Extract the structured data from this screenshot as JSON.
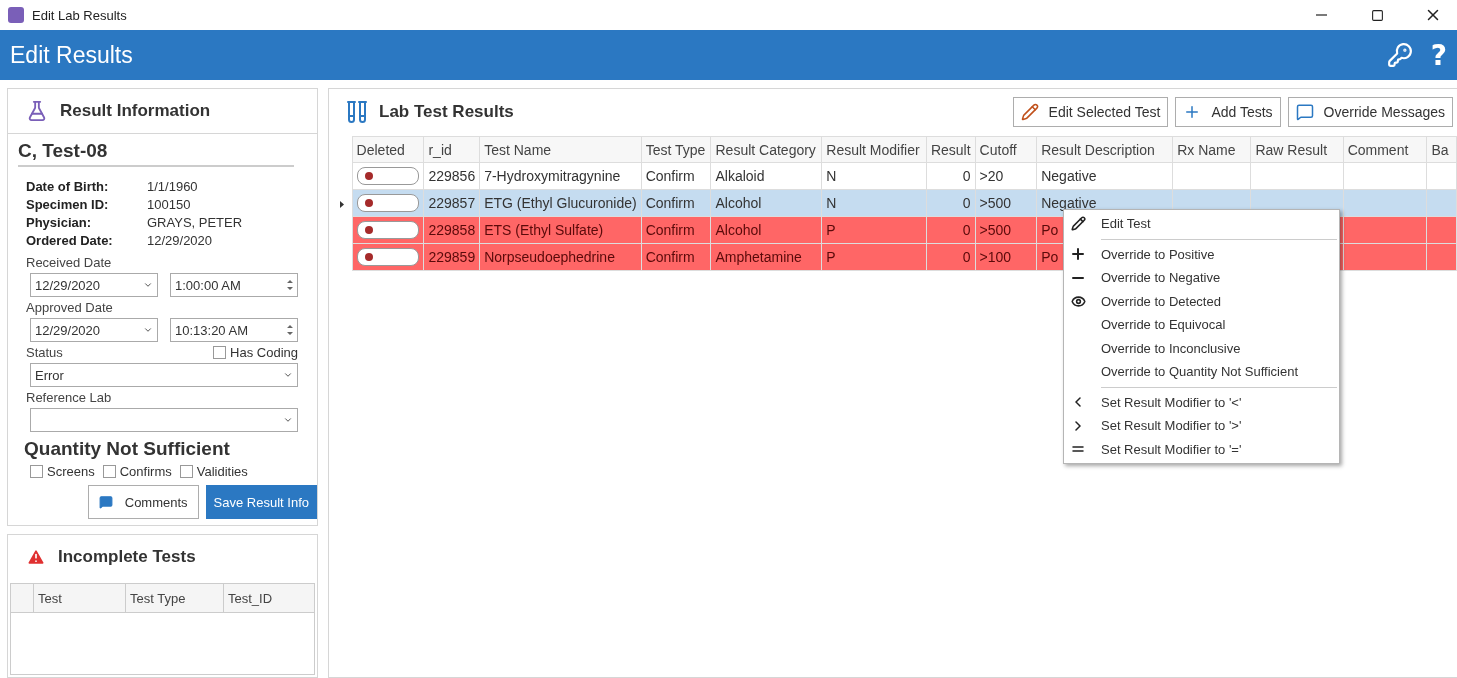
{
  "window": {
    "title": "Edit Lab Results"
  },
  "header": {
    "title": "Edit Results",
    "help": "?"
  },
  "result_info": {
    "title": "Result Information",
    "patient": "C, Test-08",
    "details": [
      {
        "label": "Date of Birth:",
        "value": "1/1/1960"
      },
      {
        "label": "Specimen ID:",
        "value": "100150"
      },
      {
        "label": "Physician:",
        "value": "GRAYS, PETER"
      },
      {
        "label": "Ordered Date:",
        "value": "12/29/2020"
      }
    ],
    "received": {
      "label": "Received Date",
      "date": "12/29/2020",
      "time": "1:00:00 AM"
    },
    "approved": {
      "label": "Approved Date",
      "date": "12/29/2020",
      "time": "10:13:20 AM"
    },
    "status": {
      "label": "Status",
      "value": "Error"
    },
    "has_coding": {
      "label": "Has Coding",
      "checked": false
    },
    "reference_lab": {
      "label": "Reference Lab"
    },
    "qns": {
      "title": "Quantity Not Sufficient",
      "options": [
        {
          "label": "Screens",
          "checked": false
        },
        {
          "label": "Confirms",
          "checked": false
        },
        {
          "label": "Validities",
          "checked": false
        }
      ]
    },
    "buttons": {
      "comments": "Comments",
      "save": "Save Result Info"
    }
  },
  "incomplete_tests": {
    "title": "Incomplete Tests",
    "columns": [
      "Test",
      "Test Type",
      "Test_ID"
    ]
  },
  "lab_results": {
    "title": "Lab Test Results",
    "toolbar": [
      {
        "kind": "edit",
        "label": "Edit Selected Test"
      },
      {
        "kind": "add",
        "label": "Add Tests"
      },
      {
        "kind": "message",
        "label": "Override Messages"
      }
    ],
    "columns": [
      "Deleted",
      "r_id",
      "Test Name",
      "Test Type",
      "Result Category",
      "Result Modifier",
      "Result",
      "Cutoff",
      "Result Description",
      "Rx Name",
      "Raw Result",
      "Comment",
      "Ba"
    ],
    "rows": [
      {
        "selected": false,
        "positive": false,
        "deleted": false,
        "cells": [
          "",
          "229856",
          "7-Hydroxymitragynine",
          "Confirm",
          "Alkaloid",
          "N",
          "0",
          ">20",
          "Negative",
          "",
          "",
          "",
          ""
        ]
      },
      {
        "selected": true,
        "positive": false,
        "deleted": false,
        "cells": [
          "",
          "229857",
          "ETG (Ethyl Glucuronide)",
          "Confirm",
          "Alcohol",
          "N",
          "0",
          ">500",
          "Negative",
          "",
          "",
          "",
          ""
        ]
      },
      {
        "selected": false,
        "positive": true,
        "deleted": false,
        "cells": [
          "",
          "229858",
          "ETS (Ethyl Sulfate)",
          "Confirm",
          "Alcohol",
          "P",
          "0",
          ">500",
          "Po",
          "",
          "",
          "",
          ""
        ]
      },
      {
        "selected": false,
        "positive": true,
        "deleted": false,
        "cells": [
          "",
          "229859",
          "Norpseudoephedrine",
          "Confirm",
          "Amphetamine",
          "P",
          "0",
          ">100",
          "Po",
          "",
          "",
          "",
          ""
        ]
      }
    ]
  },
  "context_menu": {
    "groups": [
      [
        {
          "kind": "pencil",
          "label": "Edit Test"
        }
      ],
      [
        {
          "kind": "plus",
          "label": "Override to Positive"
        },
        {
          "kind": "minus",
          "label": "Override to Negative"
        },
        {
          "kind": "eye",
          "label": "Override to Detected"
        },
        {
          "kind": "plain",
          "label": "Override to Equivocal"
        },
        {
          "kind": "plain",
          "label": "Override to Inconclusive"
        },
        {
          "kind": "plain",
          "label": "Override to Quantity Not Sufficient"
        }
      ],
      [
        {
          "kind": "less",
          "label": "Set Result Modifier to '<'"
        },
        {
          "kind": "greater",
          "label": "Set Result Modifier to '>'"
        },
        {
          "kind": "equals",
          "label": "Set Result Modifier to '='"
        }
      ]
    ]
  }
}
